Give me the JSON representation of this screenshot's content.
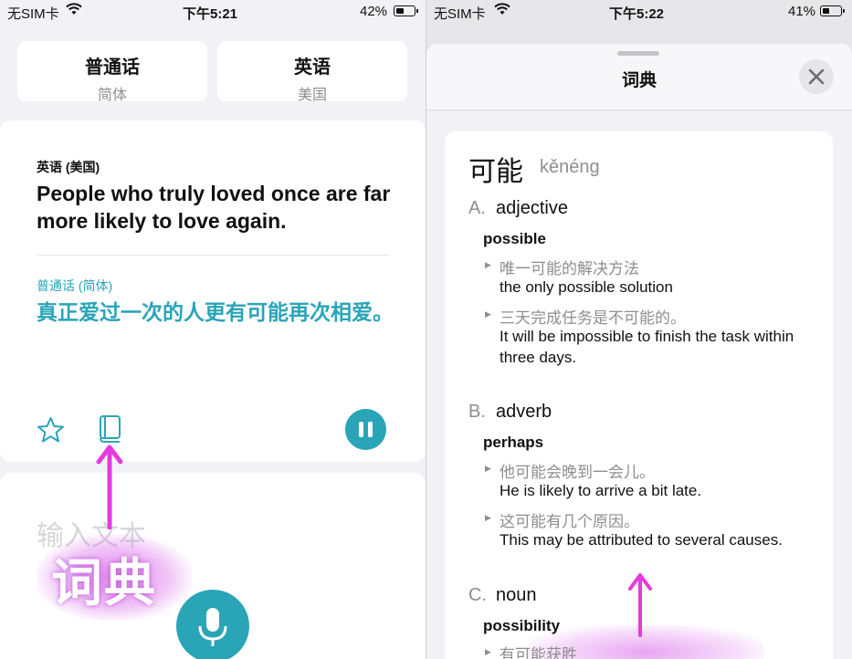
{
  "left": {
    "status": {
      "carrier": "无SIM卡",
      "time": "下午5:21",
      "battery": "42%",
      "battery_level": 0.42
    },
    "source_lang": {
      "name": "普通话",
      "region": "简体"
    },
    "target_lang": {
      "name": "英语",
      "region": "美国"
    },
    "card": {
      "source_label": "英语 (美国)",
      "source_text": "People who truly loved once are far more likely to love again.",
      "target_label": "普通话 (简体)",
      "target_text": "真正爱过一次的人更有可能再次相爱。"
    },
    "input_placeholder": "输入文本",
    "annotation": "词典",
    "icons": {
      "favorite": "star-icon",
      "dictionary": "book-icon",
      "pause": "pause-icon",
      "mic": "microphone-icon"
    },
    "colors": {
      "accent": "#2aa5b8",
      "annotation": "#d65ce8"
    }
  },
  "right": {
    "status": {
      "carrier": "无SIM卡",
      "time": "下午5:22",
      "battery": "41%",
      "battery_level": 0.41
    },
    "sheet_title": "词典",
    "headword": "可能",
    "pinyin": "kěnéng",
    "entries": [
      {
        "letter": "A.",
        "pos": "adjective",
        "sense": "possible",
        "examples": [
          {
            "zh": "唯一可能的解决方法",
            "en": "the only possible solution"
          },
          {
            "zh": "三天完成任务是不可能的。",
            "en": "It will be impossible to finish the task within three days."
          }
        ]
      },
      {
        "letter": "B.",
        "pos": "adverb",
        "sense": "perhaps",
        "examples": [
          {
            "zh": "他可能会晚到一会儿。",
            "en": "He is likely to arrive a bit late."
          },
          {
            "zh": "这可能有几个原因。",
            "en": "This may be attributed to several causes."
          }
        ]
      },
      {
        "letter": "C.",
        "pos": "noun",
        "sense": "possibility",
        "examples": [
          {
            "zh": "有可能获胜",
            "en": ""
          }
        ]
      }
    ],
    "icons": {
      "close": "close-icon",
      "bullet": "triangle-bullet-icon"
    }
  }
}
